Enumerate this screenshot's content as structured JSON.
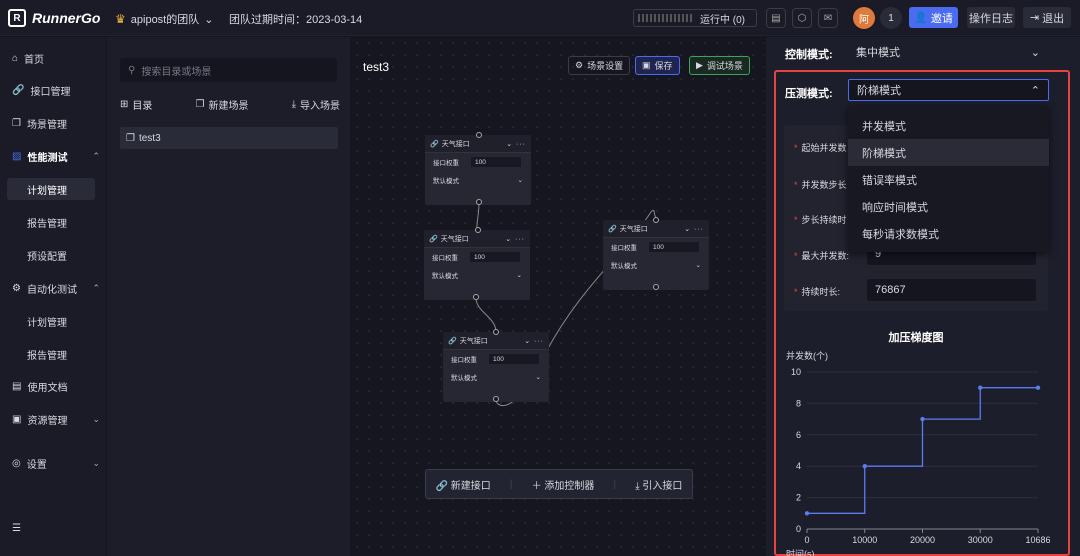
{
  "app": {
    "logo_text": "RunnerGo",
    "team": "apipost的团队",
    "expire": "团队过期时间：2023-03-14"
  },
  "header": {
    "run_status": "运行中 (0)",
    "avatar_text": "阿",
    "notify_count": "1",
    "invite": "邀请",
    "op_log": "操作日志",
    "exit": "退出"
  },
  "sidebar": {
    "home": "首页",
    "api": "接口管理",
    "scene": "场景管理",
    "perf": "性能测试",
    "plan": "计划管理",
    "report": "报告管理",
    "preset": "预设配置",
    "auto": "自动化测试",
    "auto_plan": "计划管理",
    "auto_report": "报告管理",
    "docs": "使用文档",
    "resource": "资源管理",
    "settings": "设置"
  },
  "tree": {
    "search_placeholder": "搜索目录或场景",
    "dir": "目录",
    "new_scene": "新建场景",
    "import_scene": "导入场景",
    "item": "test3"
  },
  "canvas": {
    "title": "test3",
    "scene_settings": "场景设置",
    "save": "保存",
    "debug": "调试场景",
    "node_title": "天气接口",
    "weight_label": "接口权重",
    "weight_value": "100",
    "mode": "默认模式",
    "new_api": "新建接口",
    "add_controller": "添加控制器",
    "import_api": "引入接口"
  },
  "config": {
    "control_label": "控制模式:",
    "control_value": "集中模式",
    "pressure_label": "压测模式:",
    "pressure_value": "阶梯模式",
    "options": [
      "并发模式",
      "阶梯模式",
      "错误率模式",
      "响应时间模式",
      "每秒请求数模式"
    ],
    "start_label": "起始并发数",
    "step_label": "并发数步长",
    "step_time_label": "步长持续时",
    "max_label": "最大并发数:",
    "max_value": "9",
    "duration_label": "持续时长:",
    "duration_value": "76867"
  },
  "chart_data": {
    "type": "line",
    "title": "加压梯度图",
    "ylabel": "并发数(个)",
    "xlabel": "时间(s)",
    "x": [
      0,
      10000,
      10000,
      20000,
      20000,
      30000,
      30000,
      10686
    ],
    "x_ticks": [
      "0",
      "10000",
      "20000",
      "30000",
      "10686"
    ],
    "y_ticks": [
      "0",
      "2",
      "4",
      "6",
      "8",
      "10"
    ],
    "ylim": [
      0,
      10
    ],
    "points_y": [
      1,
      1,
      4,
      4,
      7,
      7,
      9,
      9
    ],
    "points_x_index": [
      0,
      1,
      1,
      2,
      2,
      3,
      3,
      4
    ],
    "marker_y": [
      1,
      4,
      7,
      9,
      9
    ],
    "marker_x_index": [
      0,
      1,
      2,
      3,
      4
    ],
    "color": "#5b7bf0"
  }
}
